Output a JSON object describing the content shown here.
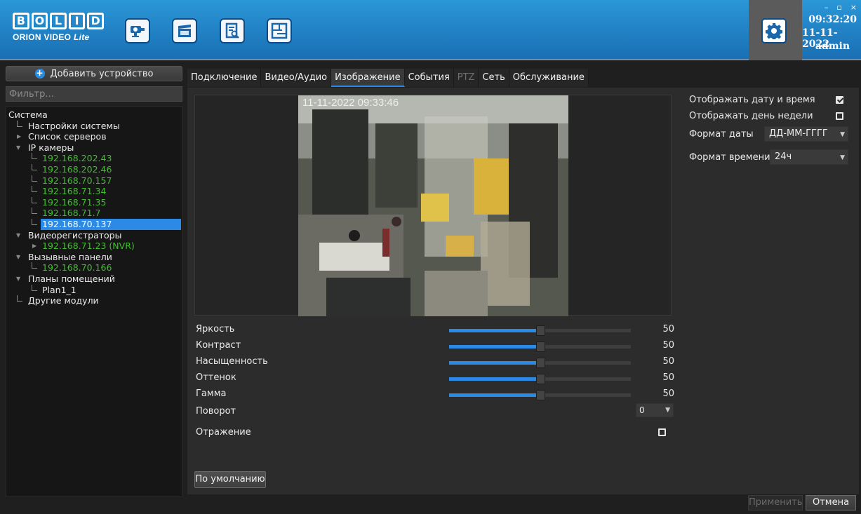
{
  "header": {
    "logo_text": "BOLID",
    "logo_sub": "ORION VIDEO",
    "logo_sub_italic": "Lite",
    "nav_icons": [
      "camera-icon",
      "clapperboard-icon",
      "document-search-icon",
      "floor-plan-icon"
    ],
    "settings_icon": "gear-icon",
    "time": "09:32:20",
    "date": "11-11-2022",
    "user": "admin",
    "accent": "#1a7fc9"
  },
  "sidebar": {
    "add_device_label": "Добавить устройство",
    "filter_placeholder": "Фильтр...",
    "tree": {
      "root": "Система",
      "system_settings": "Настройки системы",
      "servers": "Список серверов",
      "ip_cameras": "IP камеры",
      "cameras": [
        "192.168.202.43",
        "192.168.202.46",
        "192.168.70.157",
        "192.168.71.34",
        "192.168.71.35",
        "192.168.71.7",
        "192.168.70.137"
      ],
      "recorders": "Видеорегистраторы",
      "recorder_item": "192.168.71.23 (NVR)",
      "call_panels": "Вызывные панели",
      "call_panel_item": "192.168.70.166",
      "floor_plans": "Планы помещений",
      "plan_item": "Plan1_1",
      "other_modules": "Другие модули"
    }
  },
  "tabs": [
    {
      "label": "Подключение",
      "state": "normal"
    },
    {
      "label": "Видео/Аудио",
      "state": "normal"
    },
    {
      "label": "Изображение",
      "state": "active"
    },
    {
      "label": "События",
      "state": "normal"
    },
    {
      "label": "PTZ",
      "state": "disabled"
    },
    {
      "label": "Сеть",
      "state": "normal"
    },
    {
      "label": "Обслуживание",
      "state": "normal"
    }
  ],
  "image": {
    "video_timestamp": "11-11-2022 09:33:46",
    "sliders": [
      {
        "label": "Яркость",
        "value": "50"
      },
      {
        "label": "Контраст",
        "value": "50"
      },
      {
        "label": "Насыщенность",
        "value": "50"
      },
      {
        "label": "Оттенок",
        "value": "50"
      },
      {
        "label": "Гамма",
        "value": "50"
      }
    ],
    "rotation_label": "Поворот",
    "rotation_value": "0",
    "mirror_label": "Отражение",
    "default_button": "По умолчанию"
  },
  "osd": {
    "show_datetime_label": "Отображать дату и время",
    "show_weekday_label": "Отображать день недели",
    "date_format_label": "Формат даты",
    "date_format_value": "ДД-ММ-ГГГГ",
    "time_format_label": "Формат времени",
    "time_format_value": "24ч"
  },
  "footer": {
    "apply_label": "Применить",
    "cancel_label": "Отмена"
  }
}
